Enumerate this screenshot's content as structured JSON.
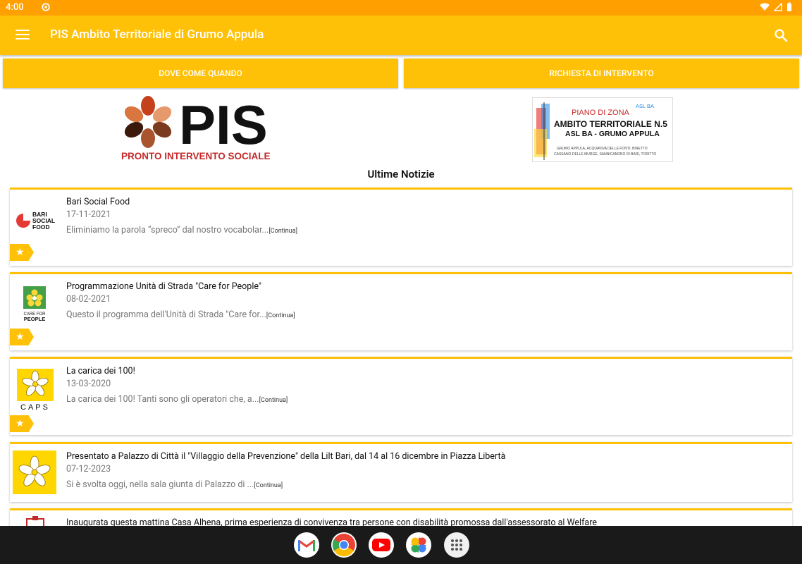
{
  "status": {
    "time": "4:00"
  },
  "appbar": {
    "title": "PIS Ambito Territoriale di Grumo Appula"
  },
  "tabs": [
    {
      "label": "DOVE COME QUANDO"
    },
    {
      "label": "RICHIESTA DI INTERVENTO"
    }
  ],
  "logos": {
    "pis": {
      "big_text": "PIS",
      "sub_text": "PRONTO INTERVENTO SOCIALE"
    },
    "pdz": {
      "badge": "ASL BA",
      "line1": "PIANO DI ZONA",
      "line2": "AMBITO TERRITORIALE N.5",
      "line3": "ASL BA - GRUMO APPULA",
      "line4": "GRUMO APPULA, ACQUAVIVA DELLE FONTI, BINETTO",
      "line5": "CASSANO DELLE MURGE, SANNICANDRO DI BARI, TORITTO"
    }
  },
  "section": {
    "title": "Ultime Notizie"
  },
  "thumb_labels": {
    "bari": [
      "BARI",
      "SOCIAL",
      "FOOD"
    ],
    "care": [
      "CARE FOR",
      "PEOPLE"
    ],
    "caps": "CAPS"
  },
  "news": [
    {
      "title": "Bari Social Food",
      "date": "17-11-2021",
      "excerpt": "Eliminiamo la parola “spreco” dal nostro vocabolar...",
      "more": "[Continua]",
      "starred": true
    },
    {
      "title": "Programmazione Unità di Strada \"Care for People\"",
      "date": "08-02-2021",
      "excerpt": "Questo il programma dell'Unità di Strada \"Care for...",
      "more": "[Continua]",
      "starred": true
    },
    {
      "title": "La carica dei 100!",
      "date": "13-03-2020",
      "excerpt": "La carica dei 100! Tanti sono gli operatori che, a...",
      "more": "[Continua]",
      "starred": true
    },
    {
      "title": "Presentato a Palazzo di Città il \"Villaggio della Prevenzione\" della Lilt Bari, dal 14 al 16 dicembre in Piazza Libertà",
      "date": "07-12-2023",
      "excerpt": "Si è svolta oggi, nella sala giunta di Palazzo di ...",
      "more": "[Continua]",
      "starred": false
    },
    {
      "title": "Inaugurata questa mattina Casa Alhena, prima esperienza di convivenza tra persone con disabilità promossa dall'assessorato al Welfare",
      "date": "",
      "excerpt": "",
      "more": "",
      "starred": false
    }
  ],
  "dock": [
    "gmail-icon",
    "chrome-icon",
    "youtube-icon",
    "photos-icon",
    "app-drawer-icon"
  ],
  "colors": {
    "status": "#ffa000",
    "appbar": "#ffc107",
    "nav": "#1a1a1a"
  }
}
